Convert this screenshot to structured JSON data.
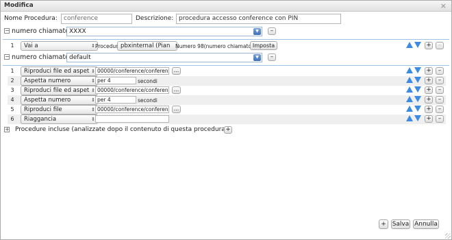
{
  "dialog": {
    "title": "Modifica",
    "close_glyph": "×"
  },
  "form": {
    "name_label": "Nome Procedura:",
    "name_value": "conference",
    "desc_label": "Descrizione:",
    "desc_value": "procedura accesso conference con PIN"
  },
  "group1": {
    "toggle": "−",
    "label": "numero chiamato",
    "value": "XXXX",
    "remove_label": "–",
    "row": {
      "num": "1",
      "action": "Vai a",
      "procedura_label": "Procedura",
      "procedura_value": "pbxinternal (Pian",
      "numero_label": "Numero 98(numero chiamato)",
      "imposta_label": "Imposta",
      "add_label": "+",
      "remove_label": "–"
    }
  },
  "group2": {
    "toggle": "−",
    "label": "numero chiamato",
    "value": "default",
    "remove_label": "–",
    "rows": [
      {
        "num": "1",
        "action": "Riproduci file ed aspet",
        "value": "00000/conference/conferenc",
        "browse": "...",
        "add": "+",
        "remove": "–"
      },
      {
        "num": "2",
        "action": "Aspetta numero",
        "value": "per 4",
        "suffix": "secondi",
        "add": "+",
        "remove": "–"
      },
      {
        "num": "3",
        "action": "Riproduci file ed aspet",
        "value": "00000/conference/conferenc",
        "browse": "...",
        "add": "+",
        "remove": "–"
      },
      {
        "num": "4",
        "action": "Aspetta numero",
        "value": "per 4",
        "suffix": "secondi",
        "add": "+",
        "remove": "–"
      },
      {
        "num": "5",
        "action": "Riproduci file",
        "value": "00000/conference/conferenc",
        "browse": "...",
        "add": "+",
        "remove": "–"
      },
      {
        "num": "6",
        "action": "Riaggancia",
        "add": "+",
        "remove": "–"
      }
    ]
  },
  "included": {
    "toggle": "+",
    "label": "Procedure incluse (analizzate dopo il contenuto di questa procedura)",
    "add_label": "+"
  },
  "footer": {
    "add_label": "+",
    "save_label": "Salva",
    "cancel_label": "Annulla"
  },
  "colors": {
    "accent_blue": "#3c8be0",
    "row_line": "#9ec3e8",
    "alt_row": "#efefef"
  },
  "icons": {
    "move_up": "arrow-up-icon",
    "move_down": "arrow-down-icon",
    "select_arrow": "updown-select-icon"
  }
}
